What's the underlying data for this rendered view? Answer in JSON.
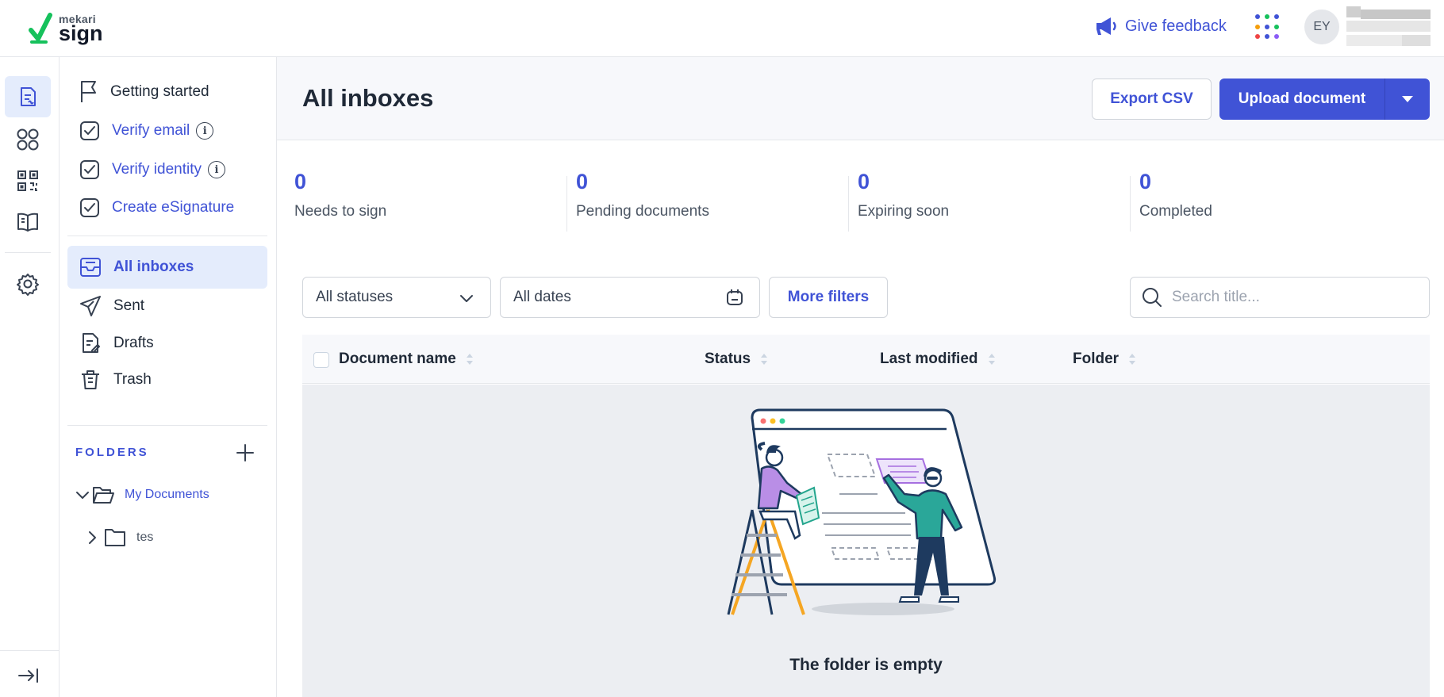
{
  "brand": {
    "small": "mekari",
    "big": "sign",
    "check_color": "#16c15c"
  },
  "header": {
    "feedback_label": "Give feedback",
    "avatar_initials": "EY",
    "app_dot_colors": [
      "#4053d6",
      "#16c15c",
      "#4053d6",
      "#f59e0b",
      "#4053d6",
      "#16c15c",
      "#ef4444",
      "#4053d6",
      "#8b5cf6"
    ]
  },
  "rail": {
    "items": [
      {
        "icon": "document-icon",
        "active": true
      },
      {
        "icon": "apps-icon",
        "active": false
      },
      {
        "icon": "qr-code-icon",
        "active": false
      },
      {
        "icon": "book-icon",
        "active": false
      },
      {
        "icon": "gear-icon",
        "active": false
      }
    ]
  },
  "sidebar": {
    "getting_started": "Getting started",
    "verify_email": "Verify email",
    "verify_identity": "Verify identity",
    "create_esignature": "Create eSignature",
    "nav": {
      "all_inboxes": "All inboxes",
      "sent": "Sent",
      "drafts": "Drafts",
      "trash": "Trash"
    },
    "folders_title": "FOLDERS",
    "folders": [
      {
        "label": "My Documents",
        "expanded": true
      },
      {
        "label": "tes",
        "expanded": false
      }
    ]
  },
  "main": {
    "title": "All inboxes",
    "export_label": "Export CSV",
    "upload_label": "Upload document",
    "stats": [
      {
        "value": "0",
        "label": "Needs to sign"
      },
      {
        "value": "0",
        "label": "Pending documents"
      },
      {
        "value": "0",
        "label": "Expiring soon"
      },
      {
        "value": "0",
        "label": "Completed"
      }
    ],
    "filters": {
      "status": "All statuses",
      "dates": "All dates",
      "more": "More filters",
      "search_placeholder": "Search title..."
    },
    "columns": [
      "Document name",
      "Status",
      "Last modified",
      "Folder"
    ],
    "empty_text": "The folder is empty"
  }
}
